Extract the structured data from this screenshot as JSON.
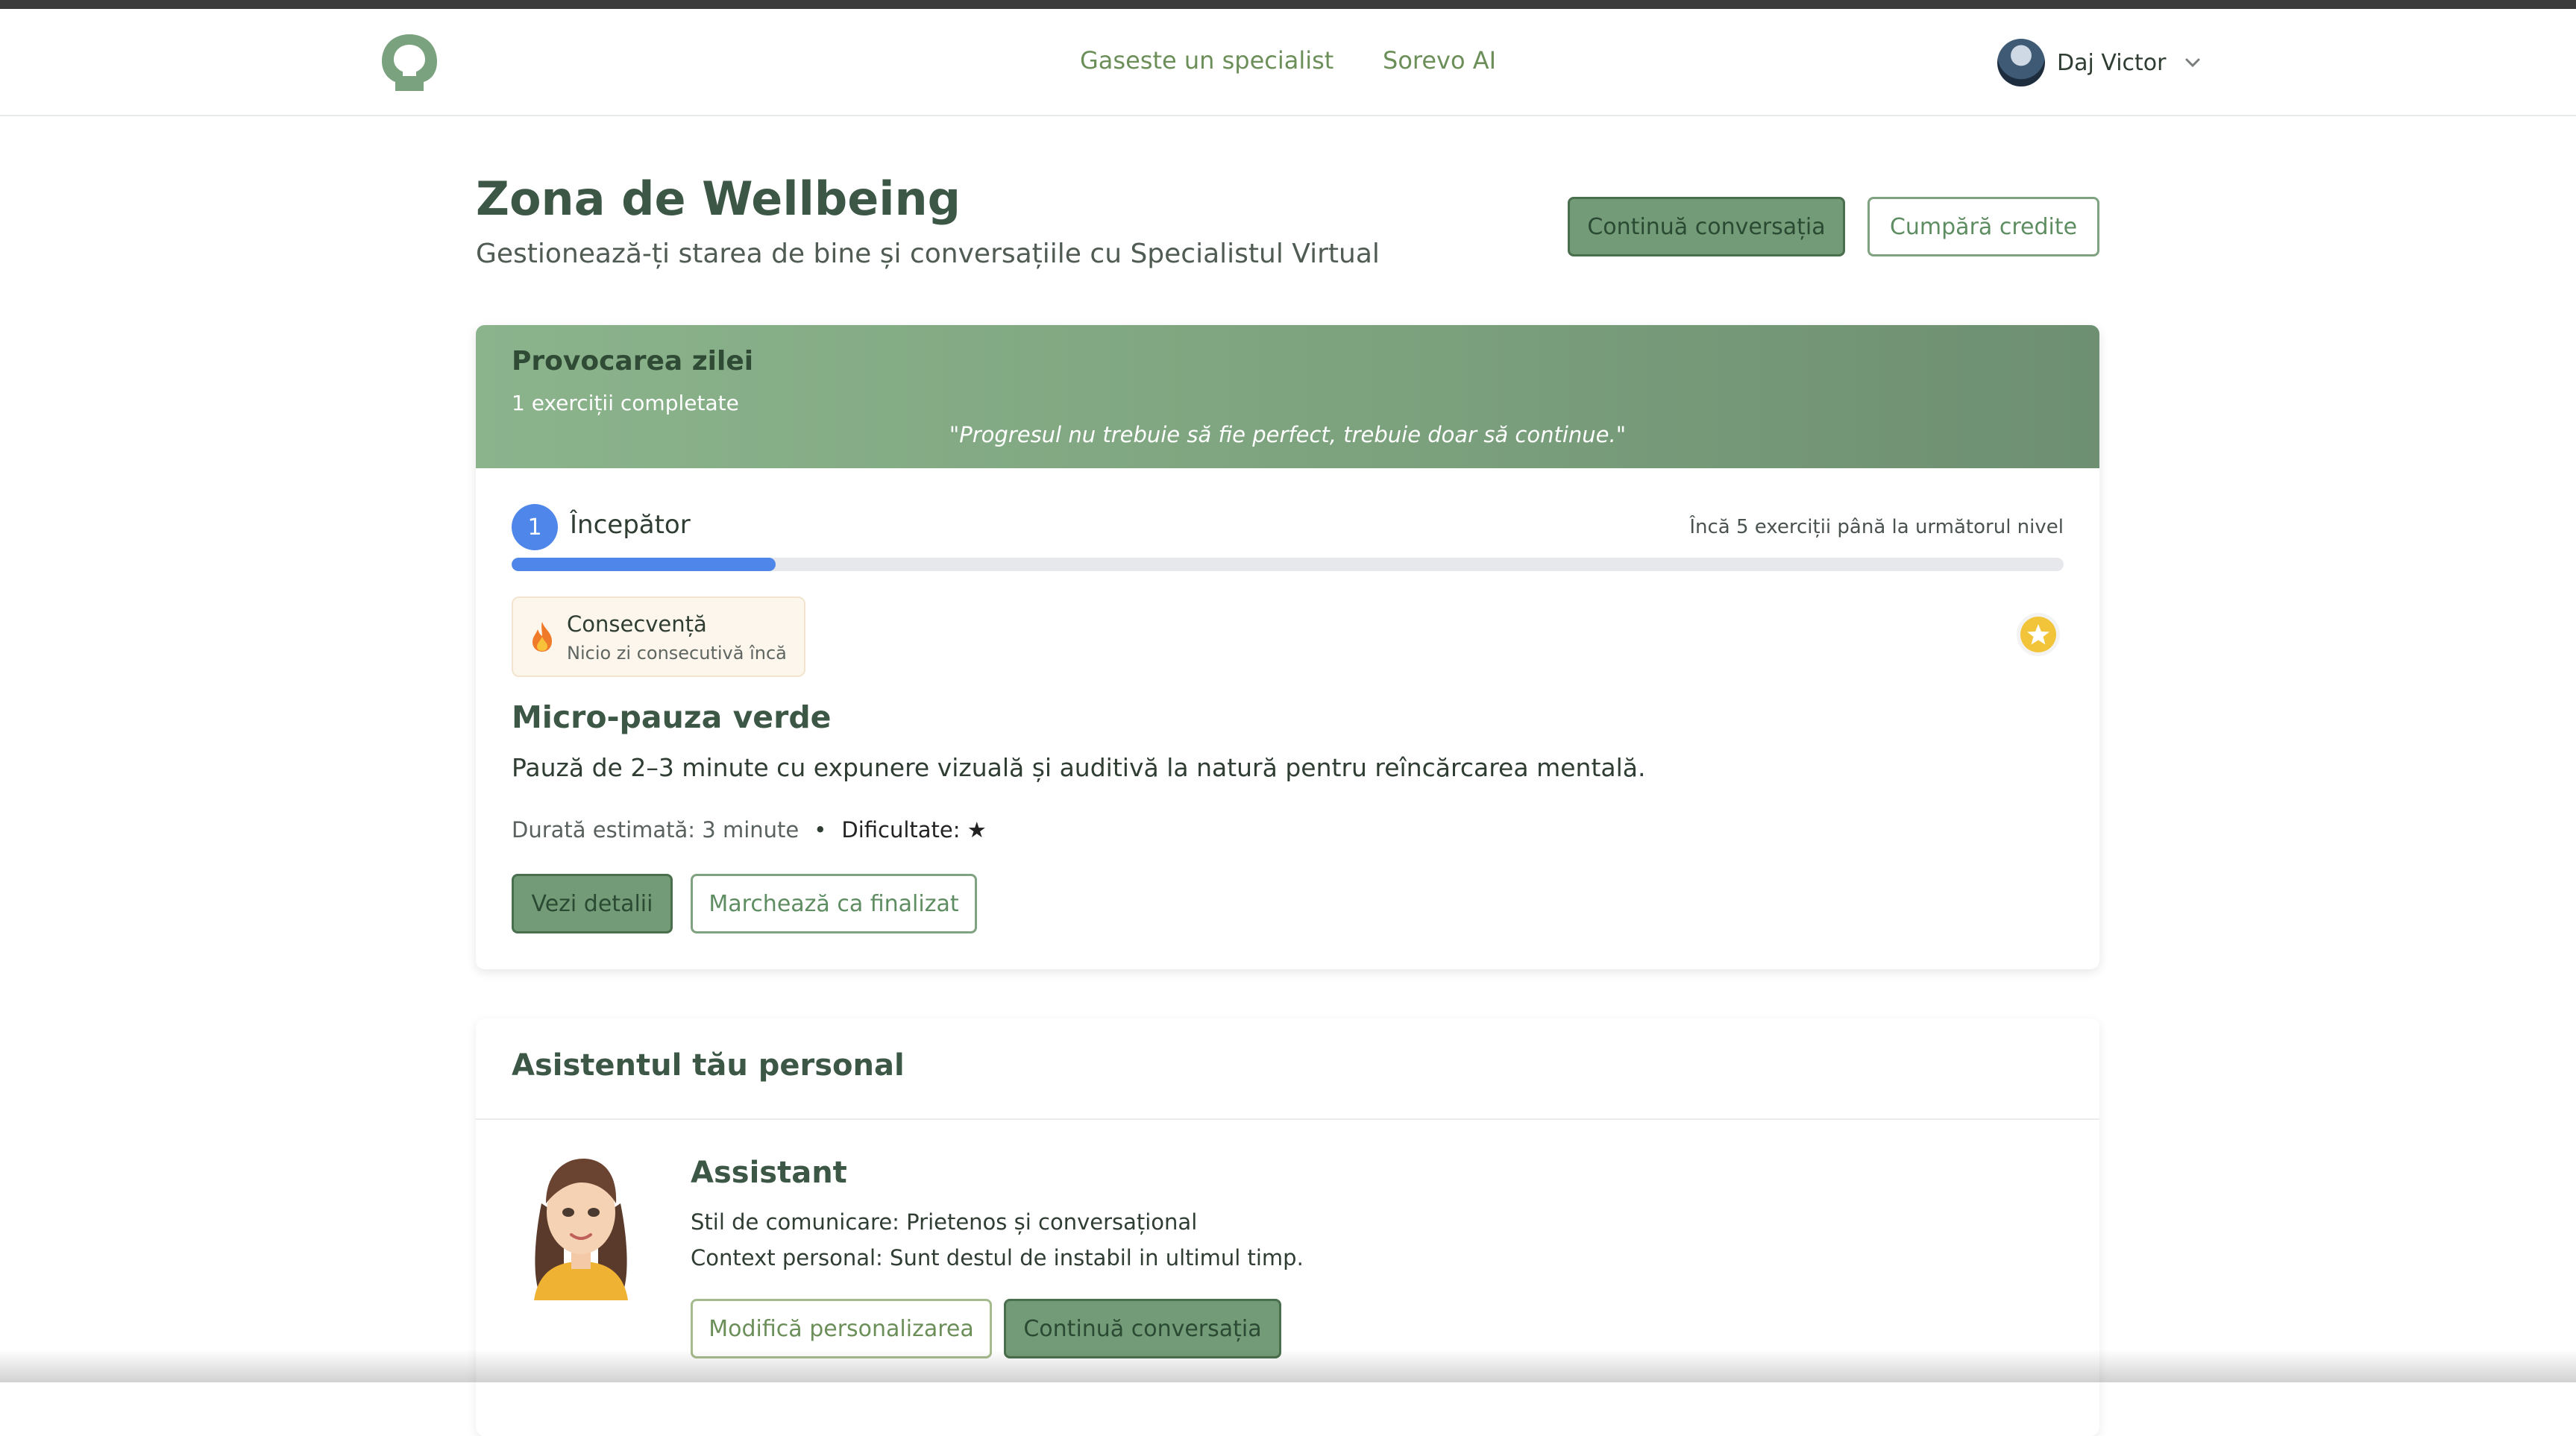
{
  "nav": {
    "links": [
      "Gaseste un specialist",
      "Sorevo AI"
    ],
    "user_name": "Daj Victor"
  },
  "page": {
    "title": "Zona de Wellbeing",
    "subtitle": "Gestionează-ți starea de bine și conversațiile cu Specialistul Virtual",
    "btn_continue": "Continuă conversația",
    "btn_buy": "Cumpără credite"
  },
  "challenge": {
    "title": "Provocarea zilei",
    "completed": "1 exerciții completate",
    "quote": "\"Progresul nu trebuie să fie perfect, trebuie doar să continue.\"",
    "level_number": "1",
    "level_name": "Începător",
    "next_level": "Încă 5 exerciții până la următorul nivel",
    "progress_fraction": 0.17,
    "streak_title": "Consecvență",
    "streak_sub": "Nicio zi consecutivă încă",
    "exercise_title": "Micro-pauza verde",
    "exercise_desc": "Pauză de 2–3 minute cu expunere vizuală și auditivă la natură pentru reîncărcarea mentală.",
    "duration": "Durată estimată: 3 minute",
    "separator": "•",
    "difficulty": "Dificultate: ★",
    "btn_details": "Vezi detalii",
    "btn_done": "Marchează ca finalizat"
  },
  "assistant": {
    "section_title": "Asistentul tău personal",
    "name": "Assistant",
    "style": "Stil de comunicare: Prietenos și conversațional",
    "context": "Context personal: Sunt destul de instabil in ultimul timp.",
    "btn_edit": "Modifică personalizarea",
    "btn_continue": "Continuă conversația"
  },
  "colors": {
    "accent_green": "#749b77",
    "dark_green": "#3c5745",
    "progress_blue": "#4f86ea"
  },
  "icons": [
    "brain-logo-icon",
    "user-avatar",
    "chevron-down-icon",
    "flame-icon",
    "star-badge-icon",
    "assistant-avatar"
  ]
}
